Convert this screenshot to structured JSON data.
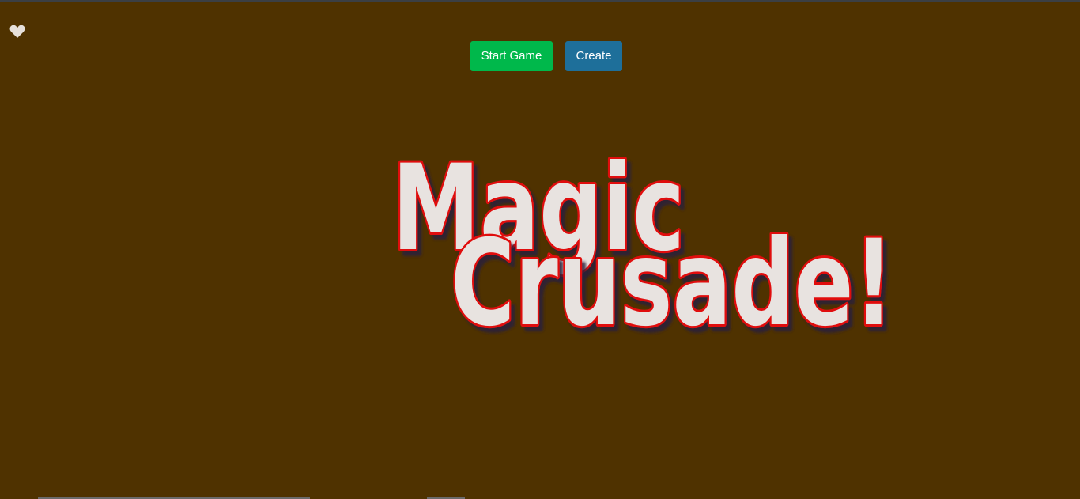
{
  "toolbar": {
    "start_label": "Start Game",
    "create_label": "Create"
  },
  "title": {
    "line1": "Magic",
    "line2": "Crusade!"
  },
  "colors": {
    "background": "#4f3200",
    "start_button": "#00b84b",
    "create_button": "#1e6f9a",
    "title_fill": "#e8e3e0",
    "title_outline": "#e01010"
  },
  "icons": {
    "favorite": "heart-icon"
  }
}
